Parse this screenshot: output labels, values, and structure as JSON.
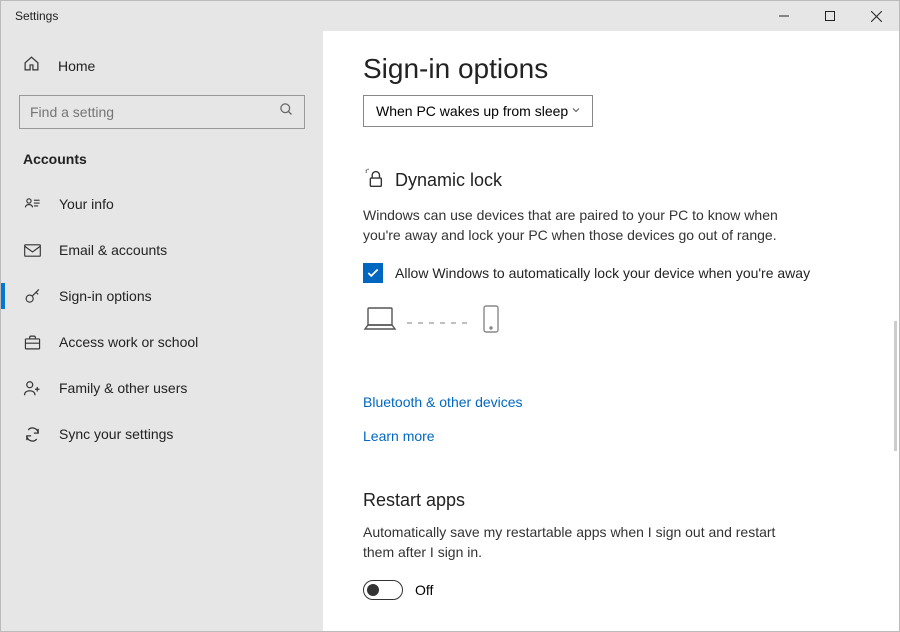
{
  "window": {
    "title": "Settings"
  },
  "sidebar": {
    "home": "Home",
    "search_placeholder": "Find a setting",
    "category": "Accounts",
    "items": [
      {
        "label": "Your info"
      },
      {
        "label": "Email & accounts"
      },
      {
        "label": "Sign-in options"
      },
      {
        "label": "Access work or school"
      },
      {
        "label": "Family & other users"
      },
      {
        "label": "Sync your settings"
      }
    ]
  },
  "main": {
    "title": "Sign-in options",
    "dropdown_value": "When PC wakes up from sleep",
    "dynamic_lock": {
      "heading": "Dynamic lock",
      "description": "Windows can use devices that are paired to your PC to know when you're away and lock your PC when those devices go out of range.",
      "checkbox_label": "Allow Windows to automatically lock your device when you're away",
      "checked": true
    },
    "links": {
      "bluetooth": "Bluetooth & other devices",
      "learn": "Learn more"
    },
    "restart_apps": {
      "heading": "Restart apps",
      "description": "Automatically save my restartable apps when I sign out and restart them after I sign in.",
      "toggle_label": "Off",
      "toggle_state": false
    }
  }
}
